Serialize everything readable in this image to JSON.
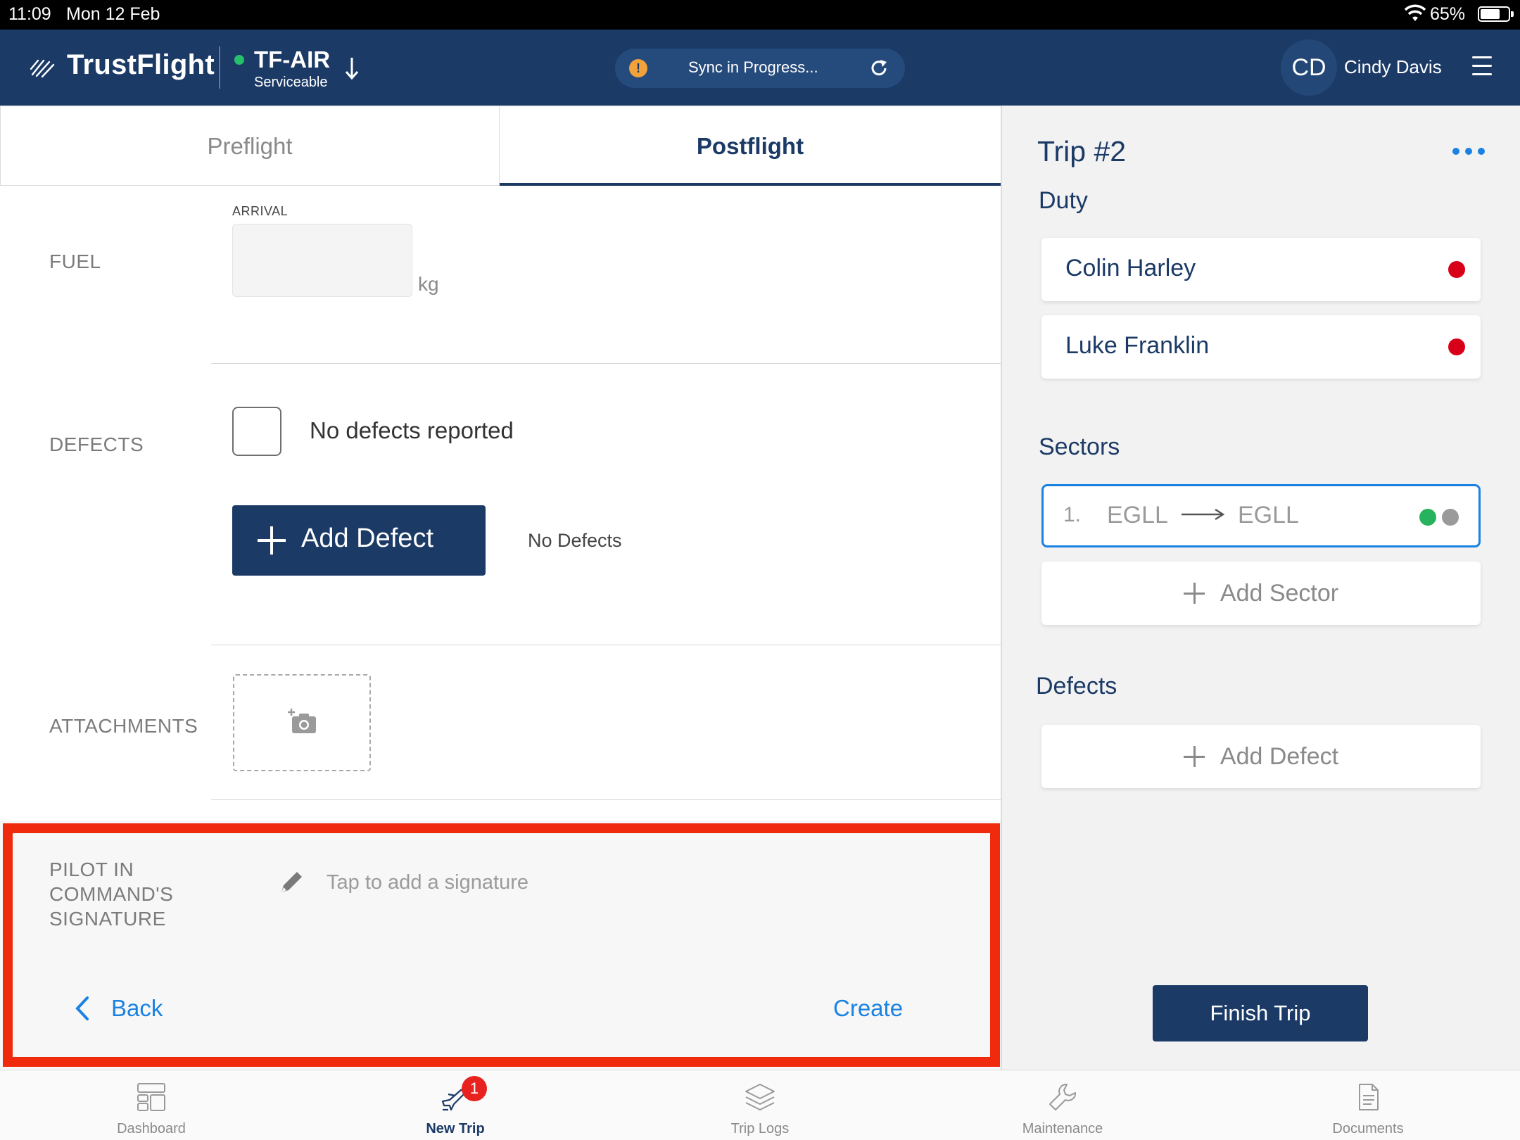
{
  "status_bar": {
    "time": "11:09",
    "date": "Mon 12 Feb",
    "battery": "65%"
  },
  "header": {
    "brand": "TrustFlight",
    "aircraft_reg": "TF-AIR",
    "aircraft_status": "Serviceable",
    "sync_text": "Sync in Progress...",
    "sync_warning": "!",
    "user_initials": "CD",
    "user_name": "Cindy Davis"
  },
  "tabs": {
    "preflight": "Preflight",
    "postflight": "Postflight",
    "active": "Postflight"
  },
  "form": {
    "fuel_label": "FUEL",
    "arrival_label": "ARRIVAL",
    "fuel_value": "",
    "fuel_unit": "kg",
    "defects_label": "DEFECTS",
    "no_defects_reported": "No defects reported",
    "add_defect": "Add Defect",
    "no_defects": "No Defects",
    "attachments_label": "ATTACHMENTS",
    "signature_label_1": "PILOT IN",
    "signature_label_2": "COMMAND'S",
    "signature_label_3": "SIGNATURE",
    "signature_placeholder": "Tap to add a signature",
    "back": "Back",
    "create": "Create"
  },
  "trip": {
    "title": "Trip #2",
    "duty_heading": "Duty",
    "crew": [
      {
        "name": "Colin Harley"
      },
      {
        "name": "Luke Franklin"
      }
    ],
    "sectors_heading": "Sectors",
    "sector": {
      "num": "1.",
      "from": "EGLL",
      "to": "EGLL"
    },
    "add_sector": "Add Sector",
    "defects_heading": "Defects",
    "add_defect": "Add Defect",
    "finish_trip": "Finish Trip"
  },
  "bottom_nav": {
    "items": [
      {
        "label": "Dashboard"
      },
      {
        "label": "New Trip",
        "badge": "1"
      },
      {
        "label": "Trip Logs"
      },
      {
        "label": "Maintenance"
      },
      {
        "label": "Documents"
      }
    ],
    "active": "New Trip"
  },
  "colors": {
    "primary": "#1b3a66",
    "link": "#1a82e2",
    "highlight": "#f02a0c",
    "status_red": "#d80019",
    "status_green": "#27b35d"
  }
}
